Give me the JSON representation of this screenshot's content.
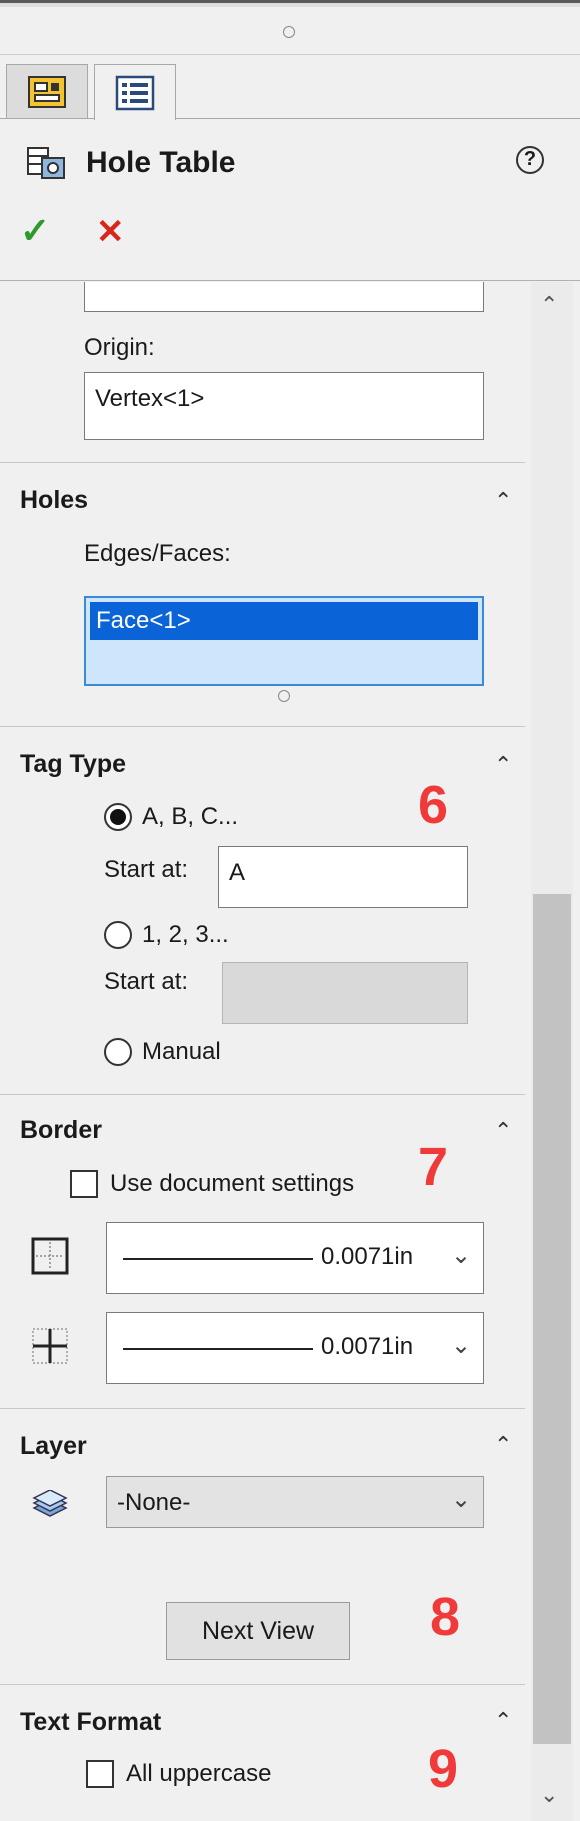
{
  "panel": {
    "title": "Hole Table",
    "help": "?",
    "ok": "✓",
    "cancel": "✕"
  },
  "datum": {
    "origin_label": "Origin:",
    "origin_value": "Vertex<1>"
  },
  "holes": {
    "title": "Holes",
    "edges_label": "Edges/Faces:",
    "selected_item": "Face<1>"
  },
  "tag_type": {
    "title": "Tag Type",
    "callout": "6",
    "opt1": "A, B, C...",
    "start_label_1": "Start at:",
    "start_value_1": "A",
    "opt2": "1, 2, 3...",
    "start_label_2": "Start at:",
    "opt3": "Manual",
    "selected": "A, B, C..."
  },
  "border": {
    "title": "Border",
    "callout": "7",
    "use_doc_label": "Use document settings",
    "outer_value": "0.0071in",
    "inner_value": "0.0071in"
  },
  "layer": {
    "title": "Layer",
    "value": "-None-",
    "callout": "8",
    "next_view": "Next View"
  },
  "text_format": {
    "title": "Text Format",
    "callout": "9",
    "uppercase_label": "All uppercase"
  },
  "icons": {
    "collapse": "⌃",
    "dropdown": "⌄",
    "scroll_up": "⌃",
    "scroll_down": "⌄"
  }
}
